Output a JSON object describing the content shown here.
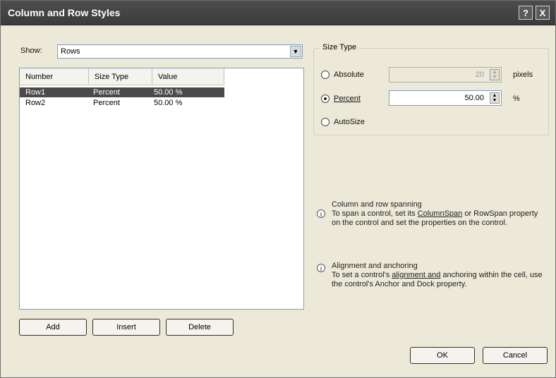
{
  "window": {
    "title": "Column and Row Styles",
    "help_label": "?",
    "close_label": "X"
  },
  "show": {
    "label": "Show:",
    "value": "Rows"
  },
  "list": {
    "headers": [
      "Number",
      "Size Type",
      "Value"
    ],
    "rows": [
      {
        "number": "Row1",
        "size_type": "Percent",
        "value": "50.00 %"
      },
      {
        "number": "Row2",
        "size_type": "Percent",
        "value": "50.00 %"
      }
    ],
    "selected_index": 0
  },
  "buttons": {
    "add": "Add",
    "insert": "Insert",
    "delete": "Delete",
    "ok": "OK",
    "cancel": "Cancel"
  },
  "size_type": {
    "group_label": "Size Type",
    "absolute": {
      "label": "Absolute",
      "value": "20",
      "unit": "pixels"
    },
    "percent": {
      "label": "Percent",
      "value": "50.00",
      "unit": "%"
    },
    "autosize": {
      "label": "AutoSize"
    },
    "selected": "percent"
  },
  "help": {
    "item1": {
      "title": "Column and row spanning",
      "text_before": "To span a control, set its ",
      "link": "ColumnSpan",
      "text_after": " or RowSpan property on the control and set the properties on the control."
    },
    "item2": {
      "title": "Alignment and anchoring",
      "text_before": "To set a control's ",
      "link": "alignment and",
      "text_after": " anchoring within the cell, use the control's Anchor and Dock property."
    }
  }
}
